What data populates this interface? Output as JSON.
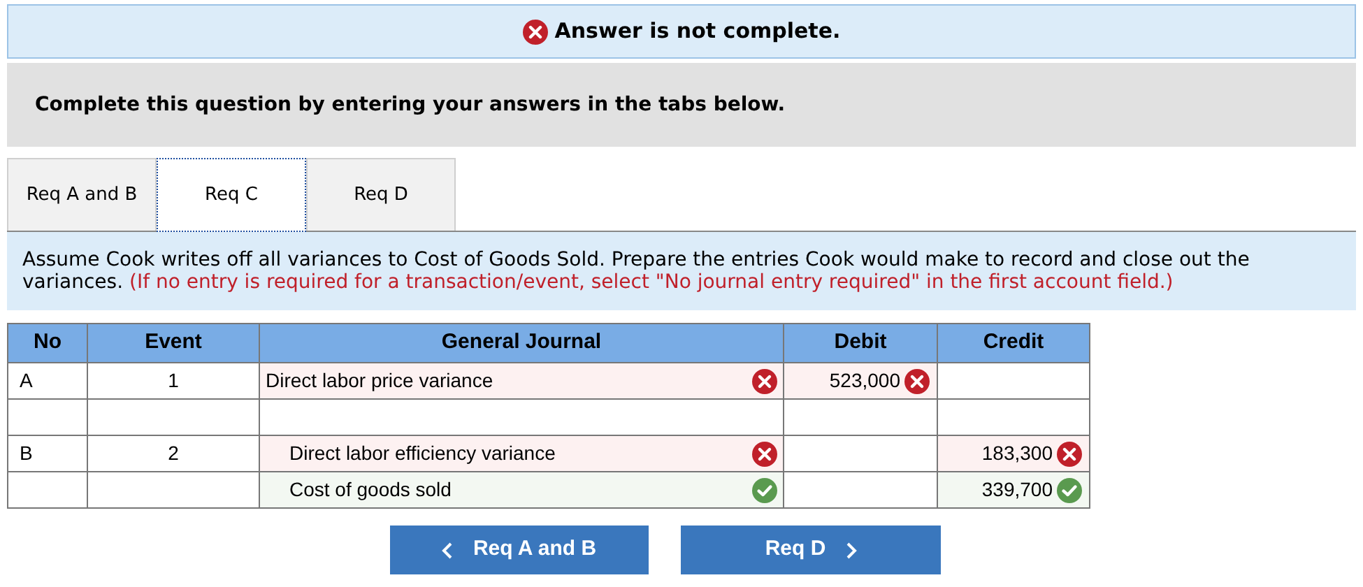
{
  "banner": {
    "complete": false,
    "text": "Answer is not complete."
  },
  "prompt": "Complete this question by entering your answers in the tabs below.",
  "tabs": [
    {
      "label": "Req A and B",
      "selected": false
    },
    {
      "label": "Req C",
      "selected": true
    },
    {
      "label": "Req D",
      "selected": false
    }
  ],
  "instructions": {
    "text": "Assume Cook writes off all variances to Cost of Goods Sold. Prepare the entries Cook would make to record and close out the variances.",
    "note": "(If no entry is required for a transaction/event, select \"No journal entry required\" in the first account field.)"
  },
  "table": {
    "columns": [
      "No",
      "Event",
      "General Journal",
      "Debit",
      "Credit"
    ],
    "rows": [
      {
        "no": "A",
        "event": "1",
        "account": {
          "text": "Direct labor price variance",
          "indented": false,
          "correct": false
        },
        "debit": {
          "text": "523,000",
          "correct": false
        }
      },
      {},
      {
        "no": "B",
        "event": "2",
        "account": {
          "text": "Direct labor efficiency variance",
          "indented": true,
          "correct": false
        },
        "credit": {
          "text": "183,300",
          "correct": false
        }
      },
      {
        "account": {
          "text": "Cost of goods sold",
          "indented": true,
          "correct": true
        },
        "credit": {
          "text": "339,700",
          "correct": true
        }
      }
    ]
  },
  "nav": {
    "prev": "Req A and B",
    "next": "Req D"
  }
}
